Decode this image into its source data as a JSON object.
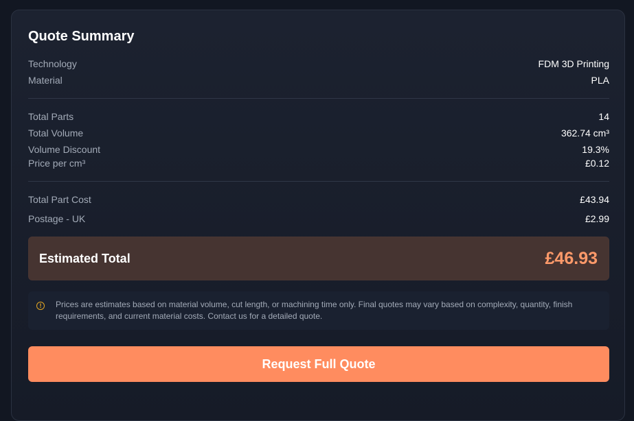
{
  "quote": {
    "title": "Quote Summary",
    "technology": {
      "label": "Technology",
      "value": "FDM 3D Printing"
    },
    "material": {
      "label": "Material",
      "value": "PLA"
    },
    "total_parts": {
      "label": "Total Parts",
      "value": "14"
    },
    "total_volume": {
      "label": "Total Volume",
      "value": "362.74 cm³"
    },
    "volume_discount": {
      "label": "Volume Discount",
      "value": "19.3%"
    },
    "price_per_cm3": {
      "label": "Price per cm³",
      "value": "£0.12"
    },
    "total_part_cost": {
      "label": "Total Part Cost",
      "value": "£43.94"
    },
    "postage": {
      "label": "Postage - UK",
      "value": "£2.99"
    },
    "estimated_total": {
      "label": "Estimated Total",
      "value": "£46.93"
    },
    "notice": {
      "icon": "warning-circle-icon",
      "icon_glyph": "!",
      "text": "Prices are estimates based on material volume, cut length, or machining time only. Final quotes may vary based on complexity, quantity, finish requirements, and current material costs. Contact us for a detailed quote."
    },
    "cta_label": "Request Full Quote"
  },
  "colors": {
    "accent": "#ff8c5f",
    "total_value": "#ff9a6a",
    "total_bg": "#463431",
    "warning": "#e5a722",
    "background": "#121722"
  }
}
